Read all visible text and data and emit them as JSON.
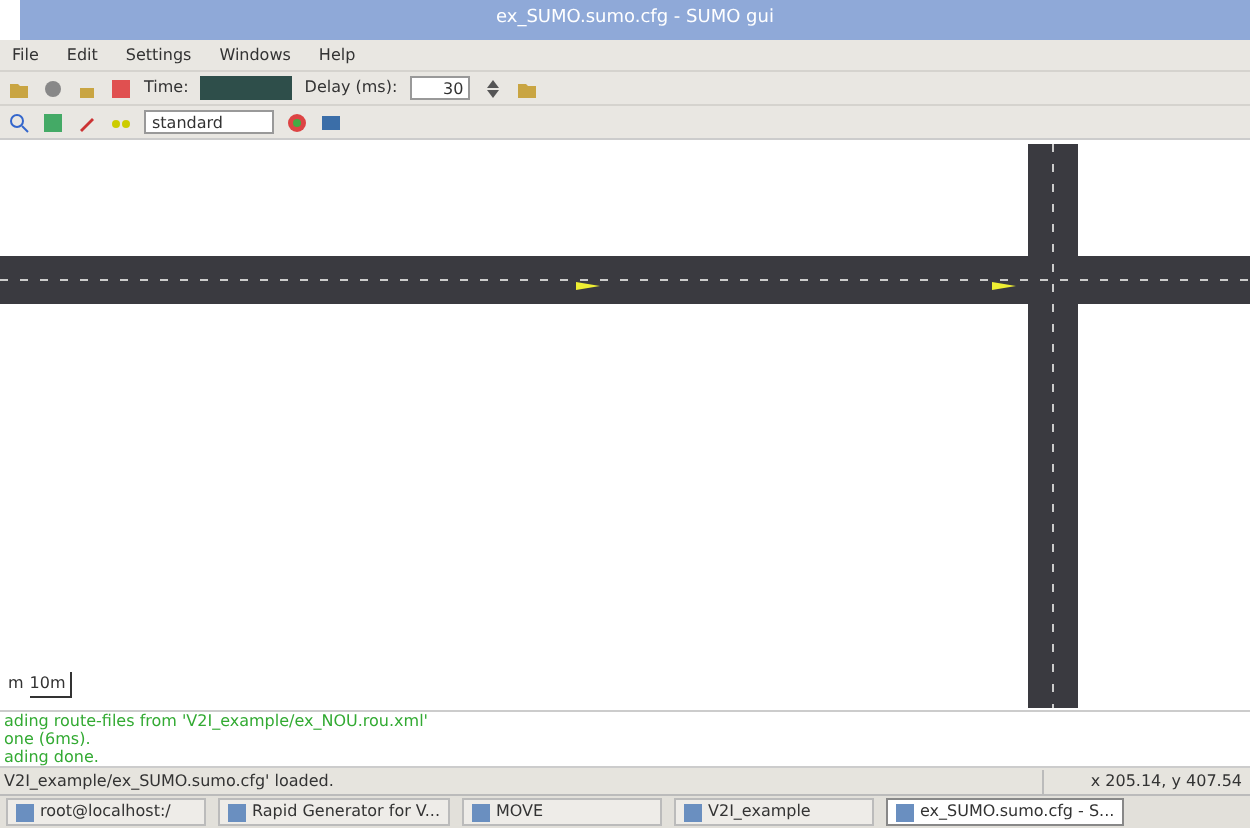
{
  "window": {
    "title": "ex_SUMO.sumo.cfg - SUMO gui"
  },
  "menu": [
    "File",
    "Edit",
    "Settings",
    "Windows",
    "Help"
  ],
  "toolbar": {
    "time_label": "Time:",
    "delay_label": "Delay (ms):",
    "delay_value": "30"
  },
  "view_toolbar": {
    "scheme": "standard"
  },
  "canvas": {
    "scale_left": "m",
    "scale_label": "10m"
  },
  "messages": [
    "ading route-files from 'V2I_example/ex_NOU.rou.xml'",
    "one (6ms).",
    "ading done."
  ],
  "status_bar": {
    "message": "V2I_example/ex_SUMO.sumo.cfg' loaded.",
    "coordinates": "x 205.14, y 407.54"
  },
  "taskbar": [
    {
      "label": "root@localhost:/",
      "selected": false
    },
    {
      "label": "Rapid Generator for V...",
      "selected": false
    },
    {
      "label": "MOVE",
      "selected": false
    },
    {
      "label": "V2I_example",
      "selected": false
    },
    {
      "label": "ex_SUMO.sumo.cfg - S...",
      "selected": true
    }
  ]
}
